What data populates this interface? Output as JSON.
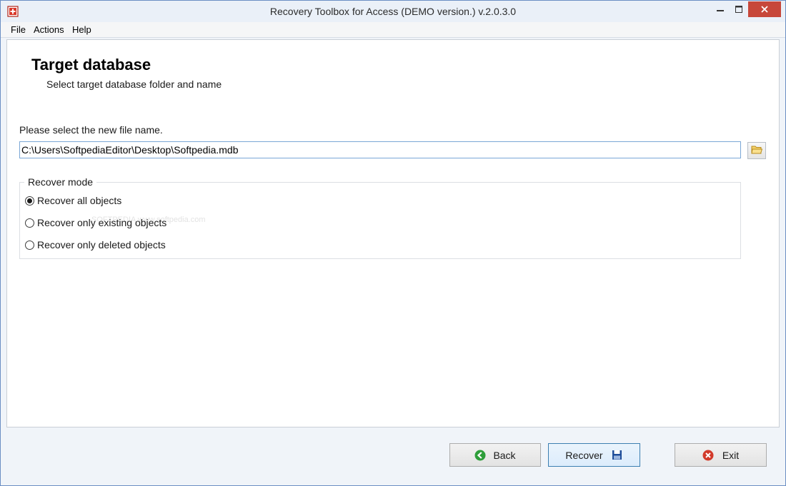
{
  "window": {
    "title": "Recovery Toolbox for Access (DEMO version.) v.2.0.3.0",
    "app_icon": "recovery-toolbox-icon",
    "controls": [
      "minimize-icon",
      "maximize-icon",
      "close-icon"
    ]
  },
  "menu": {
    "items": [
      {
        "label": "File"
      },
      {
        "label": "Actions"
      },
      {
        "label": "Help"
      }
    ]
  },
  "page": {
    "title": "Target database",
    "subtitle": "Select target database folder and name"
  },
  "file_select": {
    "prompt": "Please select the new file name.",
    "path_value": "C:\\Users\\SoftpediaEditor\\Desktop\\Softpedia.mdb",
    "browse_icon": "folder-open-icon"
  },
  "recover_mode": {
    "legend": "Recover mode",
    "options": [
      {
        "label": "Recover all objects",
        "selected": true
      },
      {
        "label": "Recover only existing objects",
        "selected": false
      },
      {
        "label": "Recover only deleted objects",
        "selected": false
      }
    ]
  },
  "watermark": "SOFTPEDIA www.softpedia.com",
  "footer": {
    "back_label": "Back",
    "recover_label": "Recover",
    "exit_label": "Exit",
    "colors": {
      "back_icon": "#2e9e3a",
      "exit_icon": "#d23a2a",
      "recover_icon": "#1f4e9a"
    }
  }
}
